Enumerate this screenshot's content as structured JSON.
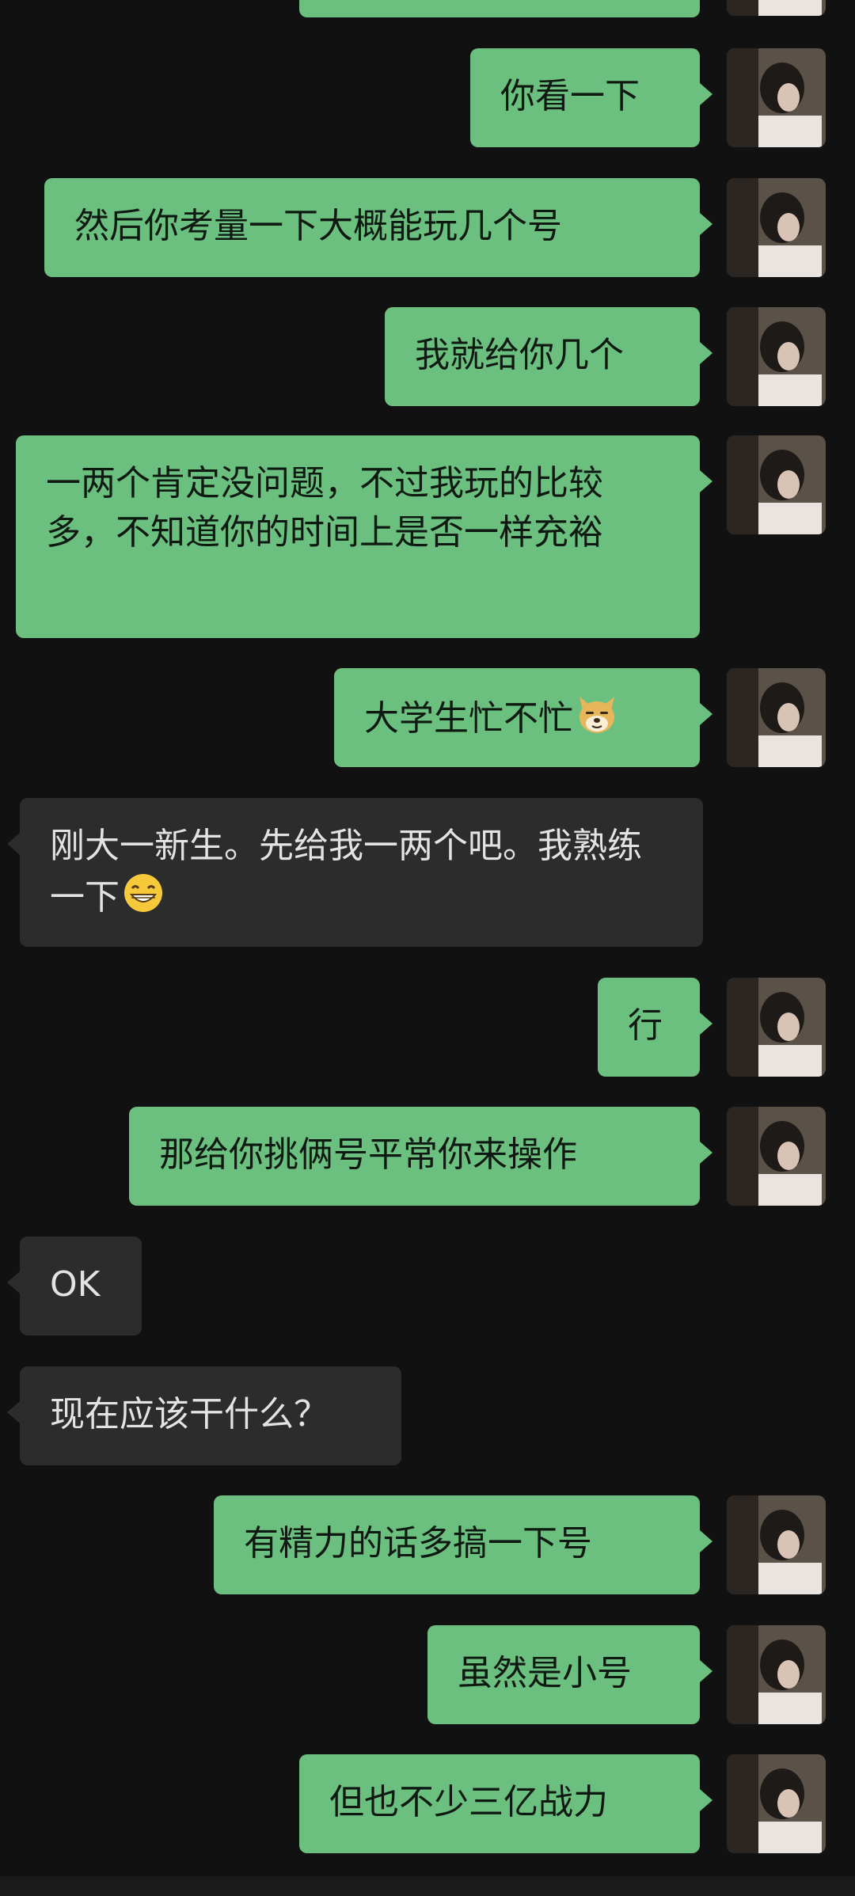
{
  "theme": {
    "background": "#111111",
    "outgoing_bubble": "#6cc07f",
    "incoming_bubble": "#2c2c2c",
    "outgoing_text": "#0e1a11",
    "incoming_text": "#e3e3e3"
  },
  "messages": [
    {
      "direction": "out",
      "text": "你看一下"
    },
    {
      "direction": "out",
      "text": "然后你考量一下大概能玩几个号"
    },
    {
      "direction": "out",
      "text": "我就给你几个"
    },
    {
      "direction": "out",
      "text": "一两个肯定没问题，不过我玩的比较多，不知道你的时间上是否一样充裕"
    },
    {
      "direction": "out",
      "text": "大学生忙不忙",
      "emoji": "doge-emoji"
    },
    {
      "direction": "in",
      "text": "刚大一新生。先给我一两个吧。我熟练一下",
      "emoji": "grin-emoji"
    },
    {
      "direction": "out",
      "text": "行"
    },
    {
      "direction": "out",
      "text": "那给你挑俩号平常你来操作"
    },
    {
      "direction": "in",
      "text": "OK"
    },
    {
      "direction": "in",
      "text": "现在应该干什么？"
    },
    {
      "direction": "out",
      "text": "有精力的话多搞一下号"
    },
    {
      "direction": "out",
      "text": "虽然是小号"
    },
    {
      "direction": "out",
      "text": "但也不少三亿战力"
    }
  ]
}
